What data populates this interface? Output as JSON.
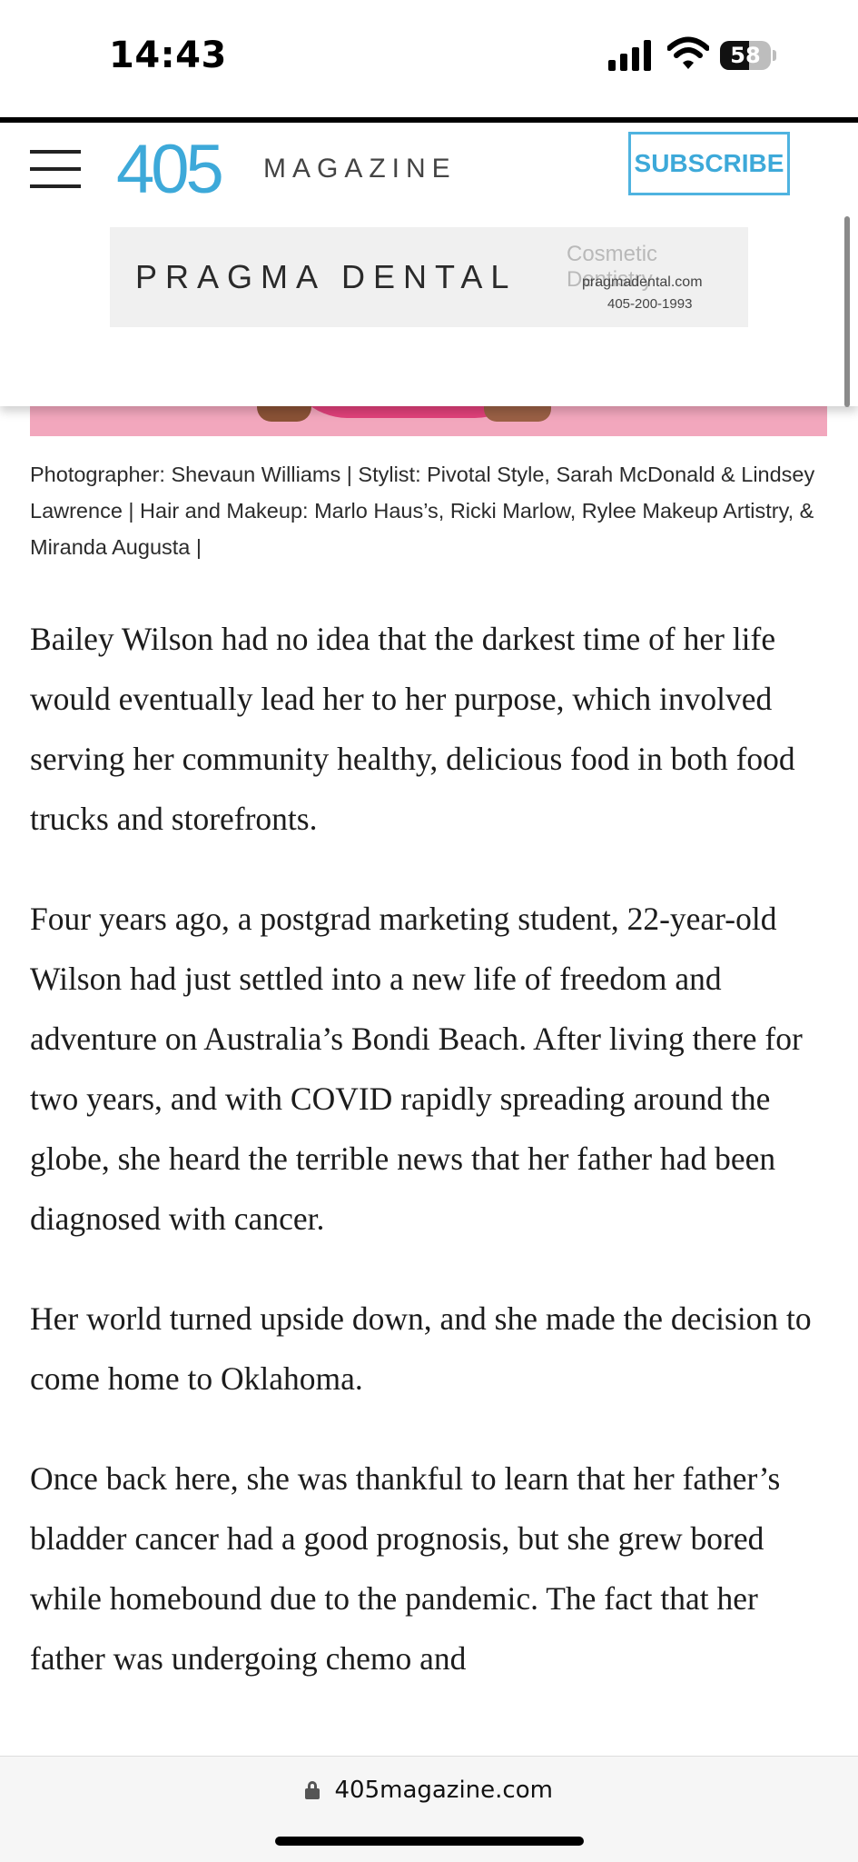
{
  "status_bar": {
    "time": "14:43",
    "battery_level": "58",
    "battery_fraction": 0.58
  },
  "header": {
    "logo_number": "405",
    "logo_word": "MAGAZINE",
    "subscribe_label": "SUBSCRIBE",
    "brand_color": "#3da9d9"
  },
  "ad": {
    "brand": "PRAGMA DENTAL",
    "tagline": "Cosmetic Dentistry",
    "url": "pragmadental.com",
    "phone": "405-200-1993"
  },
  "caption": "Photographer: Shevaun Williams | Stylist: Pivotal Style, Sarah McDonald & Lindsey Lawrence | Hair and Makeup: Marlo Haus’s, Ricki Marlow, Rylee Makeup Artistry, & Miranda Augusta |",
  "article": {
    "paragraphs": [
      "Bailey Wilson had no idea that the darkest time of her life would eventually lead her to her purpose, which involved serving her community healthy, delicious food in both food trucks and storefronts.",
      "Four years ago, a postgrad marketing student, 22-year-old Wilson had just settled into a new life of freedom and adventure on Australia’s Bondi Beach. After living there for two years, and with COVID rapidly spreading around the globe, she heard the terrible news that her father had been diagnosed with cancer.",
      "Her world turned upside down, and she made the decision to come home to Oklahoma.",
      "Once back here, she was thankful to learn that her father’s bladder cancer had a good prognosis, but she grew bored while homebound due to the pandemic. The fact that her father was undergoing chemo and"
    ]
  },
  "browser": {
    "url": "405magazine.com"
  }
}
